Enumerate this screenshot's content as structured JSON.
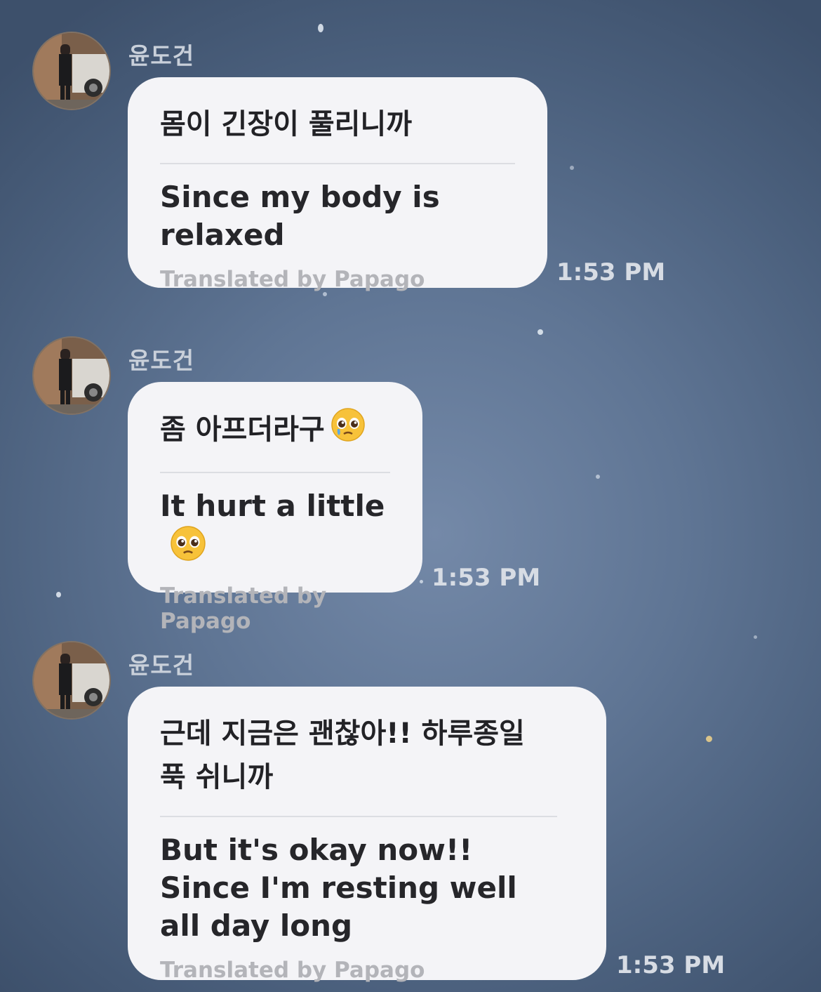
{
  "messages": [
    {
      "sender": "윤도건",
      "original": "몸이 긴장이 풀리니까",
      "translation": "Since my body is relaxed",
      "credit": "Translated by Papago",
      "time": "1:53 PM"
    },
    {
      "sender": "윤도건",
      "original": "좀 아프더라구",
      "original_emoji": "pleading-face-tear",
      "translation": "It hurt a little",
      "translation_emoji": "pleading-face",
      "credit": "Translated by Papago",
      "time": "1:53 PM"
    },
    {
      "sender": "윤도건",
      "original": "근데 지금은 괜찮아!! 하루종일 푹 쉬니까",
      "translation": "But it's okay now!! Since I'm resting well all day long",
      "credit": "Translated by Papago",
      "time": "1:53 PM"
    }
  ],
  "colors": {
    "bubble": "#f4f4f7",
    "background": "#5f7594",
    "sender_text": "#c9d0da",
    "time_text": "#d7dce4"
  }
}
